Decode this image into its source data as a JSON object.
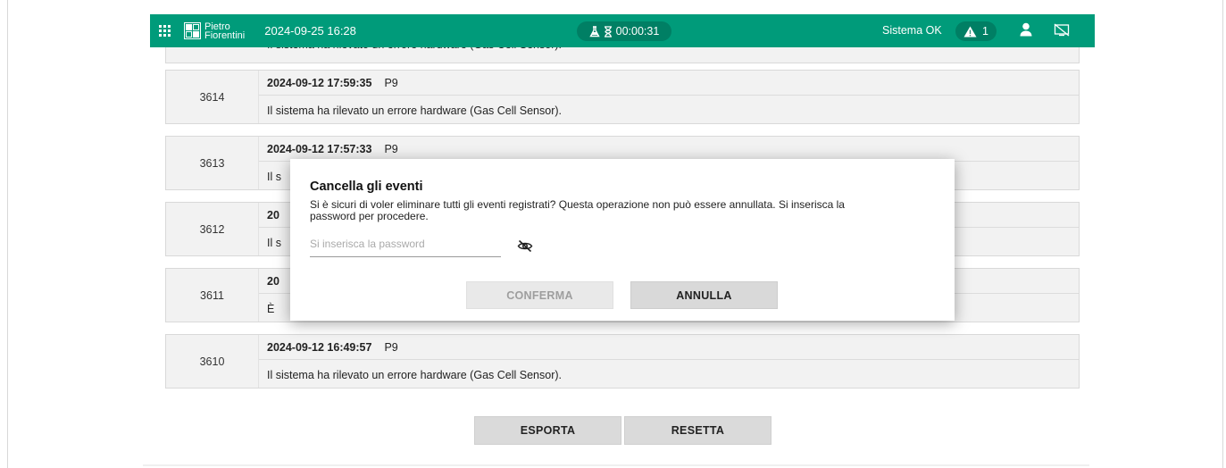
{
  "topbar": {
    "logo_line1": "Pietro",
    "logo_line2": "Fiorentini",
    "datetime": "2024-09-25 16:28",
    "timer": "00:00:31",
    "status": "Sistema OK",
    "alert_count": "1",
    "icons": [
      "apps-grid-icon",
      "flask-icon",
      "hourglass-icon",
      "warning-icon",
      "user-icon",
      "display-off-icon"
    ],
    "accent_color": "#009b7a"
  },
  "partial_row": {
    "message": "Il sistema ha rilevato un errore hardware (Gas Cell Sensor)."
  },
  "events": [
    {
      "id": "3614",
      "timestamp": "2024-09-12 17:59:35",
      "code": "P9",
      "message": "Il sistema ha rilevato un errore hardware (Gas Cell Sensor)."
    },
    {
      "id": "3613",
      "timestamp": "2024-09-12 17:57:33",
      "code": "P9",
      "message": "Il s"
    },
    {
      "id": "3612",
      "timestamp": "20",
      "code": "",
      "message": "Il s"
    },
    {
      "id": "3611",
      "timestamp": "20",
      "code": "",
      "message": "È"
    },
    {
      "id": "3610",
      "timestamp": "2024-09-12 16:49:57",
      "code": "P9",
      "message": "Il sistema ha rilevato un errore hardware (Gas Cell Sensor)."
    }
  ],
  "actions": {
    "export_label": "ESPORTA",
    "reset_label": "RESETTA"
  },
  "modal": {
    "title": "Cancella gli eventi",
    "text_line1": "Si è sicuri di voler eliminare tutti gli eventi registrati? Questa operazione non può essere annullata. Si inserisca la",
    "text_line2": "password per procedere.",
    "password_placeholder": "Si inserisca la password",
    "confirm_label": "CONFERMA",
    "cancel_label": "ANNULLA"
  }
}
